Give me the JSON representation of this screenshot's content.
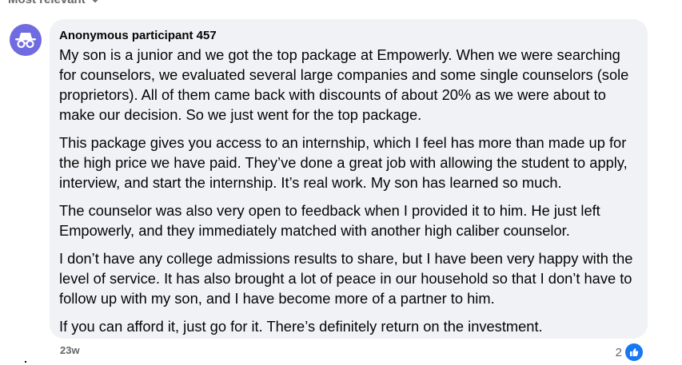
{
  "sort": {
    "label": "Most relevant",
    "icon": "chevron-down-icon"
  },
  "comment": {
    "avatar_icon": "incognito-icon",
    "avatar_color": "#6f6be0",
    "bubble_color": "#f0f2f5",
    "author": "Anonymous participant 457",
    "paragraphs": [
      "My son is a junior and we got the top package at Empowerly. When we were searching for counselors, we evaluated several large companies and some single counselors (sole proprietors). All of them came back with discounts of about 20% as we were about to make our decision. So we just went for the top package.",
      "This package gives you access to an internship, which I feel has more than made up for the high price we have paid. They’ve done a great job with allowing the student to apply, interview, and start the internship. It’s real work. My son has learned so much.",
      "The counselor was also very open to feedback when I provided it to him. He just left Empowerly, and they immediately matched with another high caliber counselor.",
      "I don’t have any college admissions results to share, but I have been very happy with the level of service. It has also brought a lot of peace in our household so that I don’t have to follow up with my son, and I have become more of a partner to him.",
      "If you can afford it, just go for it. There’s definitely return on the investment."
    ],
    "timestamp": "23w",
    "reaction_count": "2",
    "reaction_icon": "like-icon",
    "reaction_color": "#1877f2"
  }
}
